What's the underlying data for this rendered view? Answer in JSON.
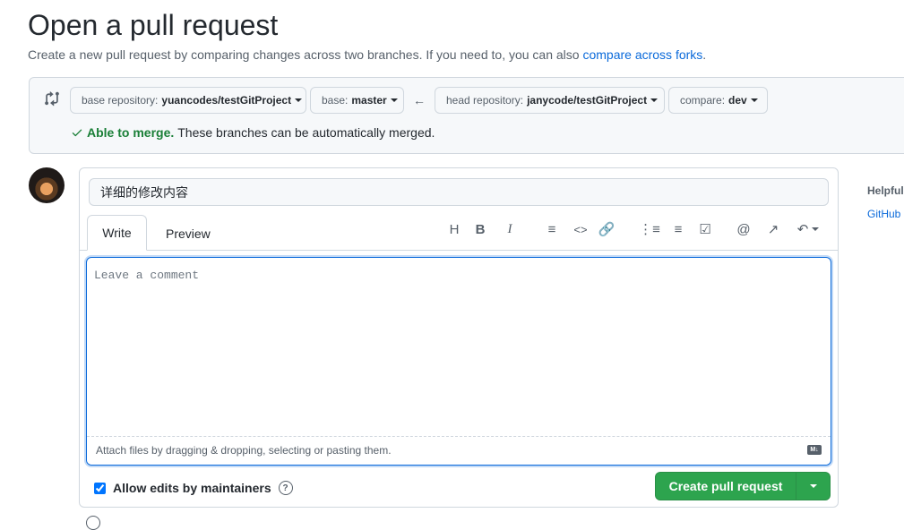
{
  "page": {
    "title": "Open a pull request",
    "subtitle_text": "Create a new pull request by comparing changes across two branches. If you need to, you can also ",
    "subtitle_link": "compare across forks",
    "subtitle_end": "."
  },
  "range": {
    "base_repo_label": "base repository:",
    "base_repo_value": "yuancodes/testGitProject",
    "base_label": "base:",
    "base_value": "master",
    "head_repo_label": "head repository:",
    "head_repo_value": "janycode/testGitProject",
    "compare_label": "compare:",
    "compare_value": "dev",
    "merge_status": "Able to merge.",
    "merge_message": "These branches can be automatically merged."
  },
  "form": {
    "title_value": "详细的修改内容",
    "tab_write": "Write",
    "tab_preview": "Preview",
    "comment_placeholder": "Leave a comment",
    "attach_hint": "Attach files by dragging & dropping, selecting or pasting them.",
    "allow_edits_label": "Allow edits by maintainers",
    "allow_edits_checked": true,
    "create_button": "Create pull request"
  },
  "toolbar": {
    "icons": [
      "heading-icon",
      "bold-icon",
      "italic-icon",
      "quote-icon",
      "code-icon",
      "link-icon",
      "bulleted-list-icon",
      "numbered-list-icon",
      "task-list-icon",
      "mention-icon",
      "cross-reference-icon",
      "reply-icon"
    ]
  },
  "sidebar": {
    "heading": "Helpful",
    "link": "GitHub"
  },
  "colors": {
    "accent": "#0969da",
    "success": "#1a7f37",
    "create_button": "#2da44e"
  }
}
